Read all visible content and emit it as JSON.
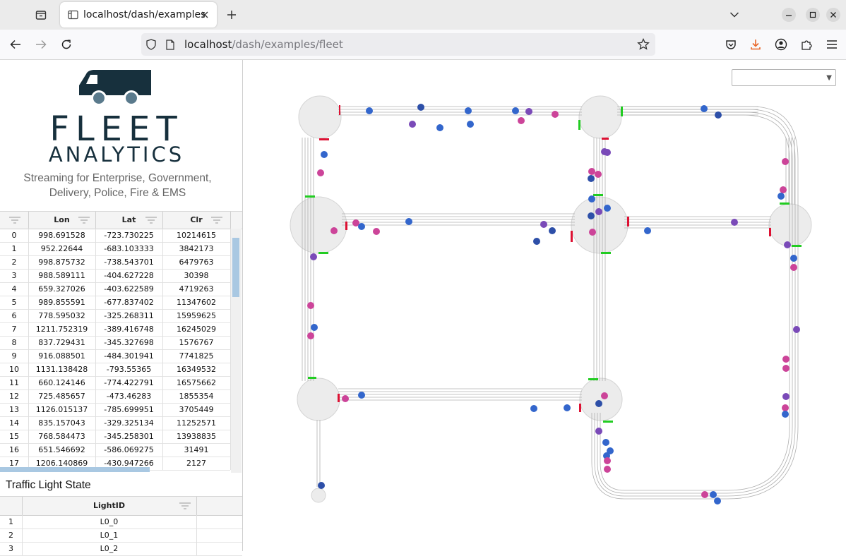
{
  "browser": {
    "tab_title": "localhost/dash/examples/",
    "url_host": "localhost",
    "url_path": "/dash/examples/fleet"
  },
  "brand": {
    "main": "FLEET",
    "sub": "ANALYTICS",
    "tagline_line1": "Streaming for Enterprise, Government,",
    "tagline_line2": "Delivery, Police, Fire & EMS"
  },
  "vehicle_table": {
    "columns": [
      "Lon",
      "Lat",
      "Clr"
    ],
    "rows": [
      {
        "i": "0",
        "lon": "998.691528",
        "lat": "-723.730225",
        "clr": "10214615"
      },
      {
        "i": "1",
        "lon": "952.22644",
        "lat": "-683.103333",
        "clr": "3842173"
      },
      {
        "i": "2",
        "lon": "998.875732",
        "lat": "-738.543701",
        "clr": "6479763"
      },
      {
        "i": "3",
        "lon": "988.589111",
        "lat": "-404.627228",
        "clr": "30398"
      },
      {
        "i": "4",
        "lon": "659.327026",
        "lat": "-403.622589",
        "clr": "4719263"
      },
      {
        "i": "5",
        "lon": "989.855591",
        "lat": "-677.837402",
        "clr": "11347602"
      },
      {
        "i": "6",
        "lon": "778.595032",
        "lat": "-325.268311",
        "clr": "15959625"
      },
      {
        "i": "7",
        "lon": "1211.752319",
        "lat": "-389.416748",
        "clr": "16245029"
      },
      {
        "i": "8",
        "lon": "837.729431",
        "lat": "-345.327698",
        "clr": "1576767"
      },
      {
        "i": "9",
        "lon": "916.088501",
        "lat": "-484.301941",
        "clr": "7741825"
      },
      {
        "i": "10",
        "lon": "1131.138428",
        "lat": "-793.55365",
        "clr": "16349532"
      },
      {
        "i": "11",
        "lon": "660.124146",
        "lat": "-774.422791",
        "clr": "16575662"
      },
      {
        "i": "12",
        "lon": "725.485657",
        "lat": "-473.46283",
        "clr": "1855354"
      },
      {
        "i": "13",
        "lon": "1126.015137",
        "lat": "-785.699951",
        "clr": "3705449"
      },
      {
        "i": "14",
        "lon": "835.157043",
        "lat": "-329.325134",
        "clr": "11252571"
      },
      {
        "i": "15",
        "lon": "768.584473",
        "lat": "-345.258301",
        "clr": "13938835"
      },
      {
        "i": "16",
        "lon": "651.546692",
        "lat": "-586.069275",
        "clr": "31491"
      },
      {
        "i": "17",
        "lon": "1206.140869",
        "lat": "-430.947266",
        "clr": "2127"
      }
    ]
  },
  "traffic_light": {
    "title": "Traffic Light State",
    "column": "LightID",
    "rows": [
      {
        "i": "1",
        "id": "L0_0"
      },
      {
        "i": "2",
        "id": "L0_1"
      },
      {
        "i": "3",
        "id": "L0_2"
      }
    ]
  },
  "map": {
    "dropdown_value": "",
    "colors": {
      "road": "#b0b0b0",
      "roundabout": "#ececec",
      "red_light": "#dd1133",
      "green_light": "#22cc22"
    },
    "vehicle_colors": [
      "#3366cc",
      "#2d4fa8",
      "#cc4499",
      "#7a4ab8"
    ]
  }
}
